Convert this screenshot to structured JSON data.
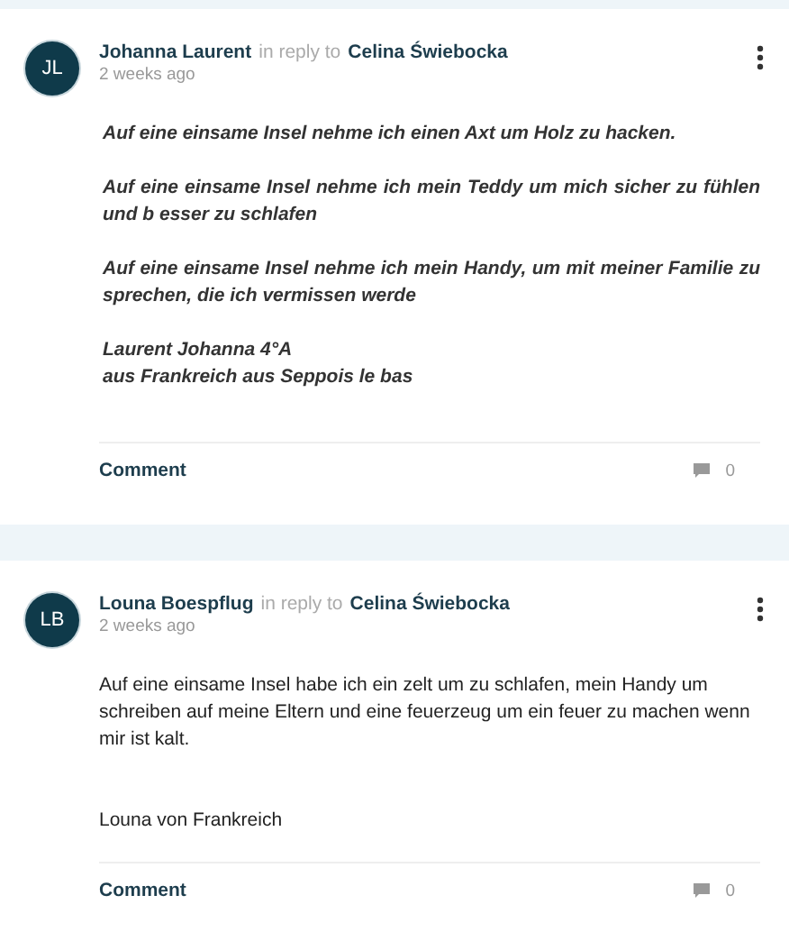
{
  "comments": [
    {
      "initials": "JL",
      "author": "Johanna Laurent",
      "reply_text": "in reply to",
      "reply_to": "Celina Świebocka",
      "time": "2 weeks ago",
      "italic": true,
      "paragraphs": [
        "Auf eine einsame Insel nehme ich einen Axt um Holz zu hacken.",
        "Auf eine einsame Insel nehme ich mein Teddy um mich sicher zu fühlen und  b esser zu schlafen",
        "Auf eine einsame Insel nehme ich mein Handy, um mit meiner Familie zu sprechen, die ich vermissen werde",
        "Laurent Johanna 4°A\naus Frankreich aus Seppois le bas"
      ],
      "action": "Comment",
      "count": "0"
    },
    {
      "initials": "LB",
      "author": "Louna Boespflug",
      "reply_text": "in reply to",
      "reply_to": "Celina Świebocka",
      "time": "2 weeks ago",
      "italic": false,
      "paragraphs": [
        "Auf eine einsame Insel habe ich ein zelt um zu schlafen, mein Handy um schreiben auf meine Eltern und eine feuerzeug um ein feuer zu machen wenn mir ist kalt.",
        "Louna von Frankreich"
      ],
      "action": "Comment",
      "count": "0"
    }
  ]
}
